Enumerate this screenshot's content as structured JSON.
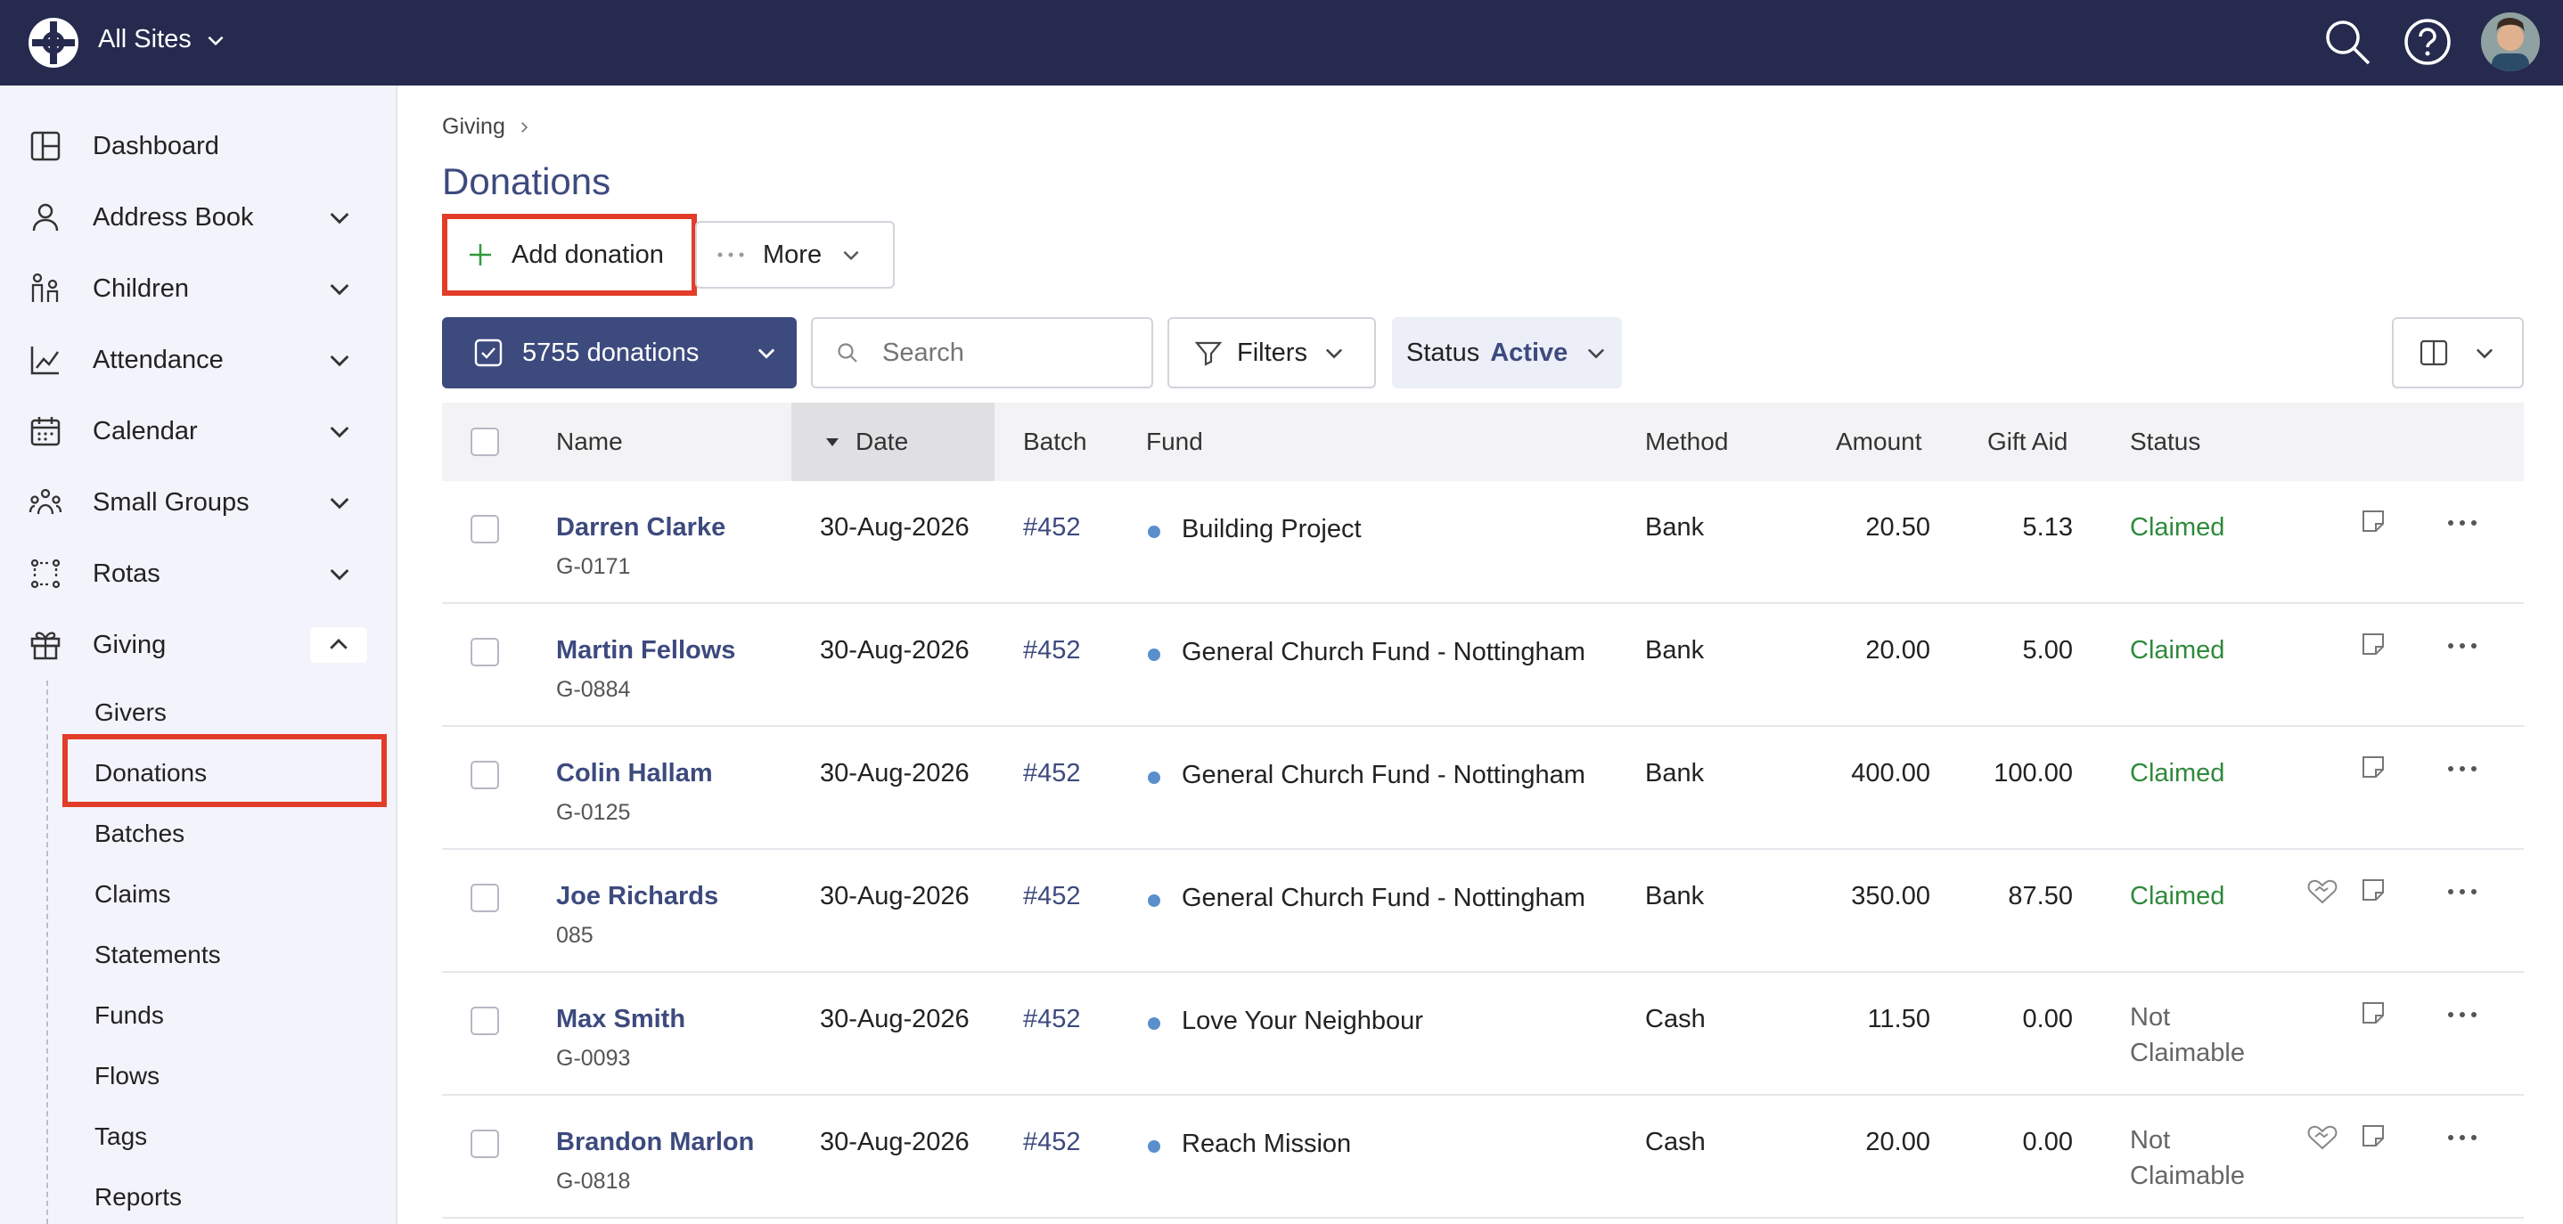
{
  "topbar": {
    "site": "All Sites"
  },
  "sidebar": {
    "items": [
      {
        "label": "Dashboard"
      },
      {
        "label": "Address Book"
      },
      {
        "label": "Children"
      },
      {
        "label": "Attendance"
      },
      {
        "label": "Calendar"
      },
      {
        "label": "Small Groups"
      },
      {
        "label": "Rotas"
      },
      {
        "label": "Giving"
      }
    ],
    "sub_items": [
      "Givers",
      "Donations",
      "Batches",
      "Claims",
      "Statements",
      "Funds",
      "Flows",
      "Tags",
      "Reports"
    ]
  },
  "breadcrumb": {
    "parent": "Giving"
  },
  "page": {
    "title": "Donations"
  },
  "toolbar": {
    "add_label": "Add donation",
    "more_label": "More",
    "count_label": "5755 donations",
    "search_placeholder": "Search",
    "filters_label": "Filters",
    "status_label": "Status",
    "status_value": "Active"
  },
  "table": {
    "headers": {
      "name": "Name",
      "date": "Date",
      "batch": "Batch",
      "fund": "Fund",
      "method": "Method",
      "amount": "Amount",
      "gift_aid": "Gift Aid",
      "status": "Status"
    },
    "rows": [
      {
        "name": "Darren Clarke",
        "ref": "G-0171",
        "date": "30-Aug-2026",
        "batch": "#452",
        "fund": "Building Project",
        "method": "Bank",
        "amount": "20.50",
        "gift_aid": "5.13",
        "status": "Claimed"
      },
      {
        "name": "Martin Fellows",
        "ref": "G-0884",
        "date": "30-Aug-2026",
        "batch": "#452",
        "fund": "General Church Fund - Nottingham",
        "method": "Bank",
        "amount": "20.00",
        "gift_aid": "5.00",
        "status": "Claimed"
      },
      {
        "name": "Colin Hallam",
        "ref": "G-0125",
        "date": "30-Aug-2026",
        "batch": "#452",
        "fund": "General Church Fund - Nottingham",
        "method": "Bank",
        "amount": "400.00",
        "gift_aid": "100.00",
        "status": "Claimed"
      },
      {
        "name": "Joe Richards",
        "ref": "085",
        "date": "30-Aug-2026",
        "batch": "#452",
        "fund": "General Church Fund - Nottingham",
        "method": "Bank",
        "amount": "350.00",
        "gift_aid": "87.50",
        "status": "Claimed"
      },
      {
        "name": "Max Smith",
        "ref": "G-0093",
        "date": "30-Aug-2026",
        "batch": "#452",
        "fund": "Love Your Neighbour",
        "method": "Cash",
        "amount": "11.50",
        "gift_aid": "0.00",
        "status_line1": "Not",
        "status_line2": "Claimable"
      },
      {
        "name": "Brandon Marlon",
        "ref": "G-0818",
        "date": "30-Aug-2026",
        "batch": "#452",
        "fund": "Reach Mission",
        "method": "Cash",
        "amount": "20.00",
        "gift_aid": "0.00",
        "status_line1": "Not",
        "status_line2": "Claimable"
      }
    ]
  },
  "colors": {
    "navy": "#252a4e",
    "accent": "#3d4a7e",
    "highlight": "#e23d28",
    "claimed": "#2f8a3b",
    "fund_dot": "#5a8fcc"
  }
}
